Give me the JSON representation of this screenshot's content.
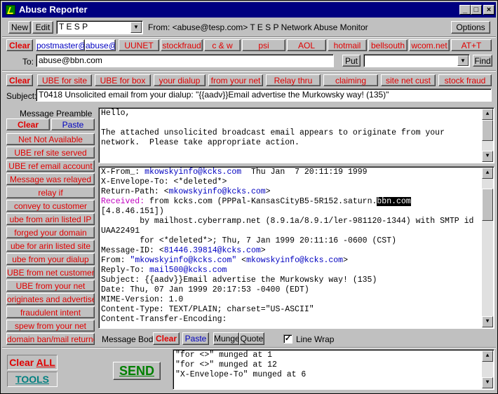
{
  "window": {
    "title": "Abuse Reporter"
  },
  "toolbar": {
    "new_label": "New",
    "edit_label": "Edit",
    "profile_value": "T E S P",
    "from_text": "From: <abuse@tesp.com> T E S P  Network Abuse Monitor",
    "options_label": "Options"
  },
  "recipients": {
    "clear_label": "Clear",
    "buttons": [
      "postmaster@",
      "abuse@",
      "UUNET",
      "stockfraud",
      "c & w",
      "psi",
      "AOL",
      "hotmail",
      "bellsouth",
      "wcom.net",
      "AT+T"
    ],
    "to_label": "To:",
    "to_value": "abuse@bbn.com",
    "put_label": "Put",
    "find_value": "",
    "find_label": "Find"
  },
  "subject_row": {
    "clear_label": "Clear",
    "buttons": [
      "UBE for site",
      "UBE for box",
      "your dialup",
      "from your net",
      "Relay thru",
      "claiming",
      "site net cust",
      "stock fraud"
    ],
    "subject_label": "Subject:",
    "subject_value": "T0418 Unsolicited email from your dialup:  \"{{aadv}}Email advertise the Murkowsky way! (135)\""
  },
  "preamble": {
    "header": "Message Preamble",
    "clear_label": "Clear",
    "paste_label": "Paste",
    "items": [
      "Net Not Available",
      "UBE ref site served",
      "UBE ref email account",
      "Message was relayed",
      "relay if",
      "convey to customer",
      "ube from arin listed IP",
      "forged your domain",
      "ube for arin listed site",
      "ube from your dialup",
      "UBE from net customer",
      "UBE from your net",
      "originates and advertises",
      "fraudulent intent",
      "spew from your net",
      "domain ban/mail returned"
    ],
    "text_lines": [
      "Hello,",
      "",
      "The attached unsolicited broadcast email appears to originate from your",
      "network.  Please take appropriate action."
    ]
  },
  "body": {
    "lines": [
      {
        "pre": "X-From_: ",
        "em": "mkowskyinfo@kcks.com",
        "post": "  Thu Jan  7 20:11:19 1999"
      },
      {
        "pre": "X-Envelope-To: <*deleted*>"
      },
      {
        "pre": "Return-Path: <",
        "em": "mkowskyinfo@kcks.com",
        "post": ">"
      },
      {
        "rcv": "Received:",
        "pre": " from kcks.com (PPPal-KansasCityB5-5R152.saturn.",
        "hl": "bbn.com"
      },
      {
        "pre": "[4.8.46.151])"
      },
      {
        "pre": "        by mailhost.cyberramp.net (8.9.1a/8.9.1/ler-981120-1344) with SMTP id"
      },
      {
        "pre": "UAA22491"
      },
      {
        "pre": "        for <*deleted*>; Thu, 7 Jan 1999 20:11:16 -0600 (CST)"
      },
      {
        "pre": "Message-ID: <",
        "em": "81446.39814@kcks.com",
        "post": ">"
      },
      {
        "pre": "From: ",
        "em": "\"mkowskyinfo@kcks.com\"",
        "post": " <",
        "em2": "mkowskyinfo@kcks.com",
        "post2": ">"
      },
      {
        "pre": "Reply-To: ",
        "em": "mail500@kcks.com"
      },
      {
        "pre": "Subject: {{aadv}}Email advertise the Murkowsky way! (135)"
      },
      {
        "pre": "Date: Thu, 07 Jan 1999 20:17:53 -0400 (EDT)"
      },
      {
        "pre": "MIME-Version: 1.0"
      },
      {
        "pre": "Content-Type: TEXT/PLAIN; charset=\"US-ASCII\""
      },
      {
        "pre": "Content-Transfer-Encoding:"
      }
    ],
    "label": "Message Body",
    "clear_label": "Clear",
    "paste_label": "Paste",
    "munge_label": "Munge",
    "quote_label": "Quote",
    "linewrap_label": "Line Wrap",
    "linewrap_checked": "✓"
  },
  "footer": {
    "clear_all_prefix": "Clear ",
    "clear_all_suffix": "ALL",
    "tools_label": "TOOLS",
    "send_label": "SEND",
    "log_lines": [
      "\"for <>\" munged at 1",
      "\"for <>\" munged at 12",
      "\"X-Envelope-To\" munged at 6"
    ]
  },
  "colors": {
    "titlebar": "#000080",
    "red_label": "#e00000",
    "email_link": "#0000c0",
    "received": "#c000c0",
    "send": "#008000",
    "tools": "#008080"
  }
}
